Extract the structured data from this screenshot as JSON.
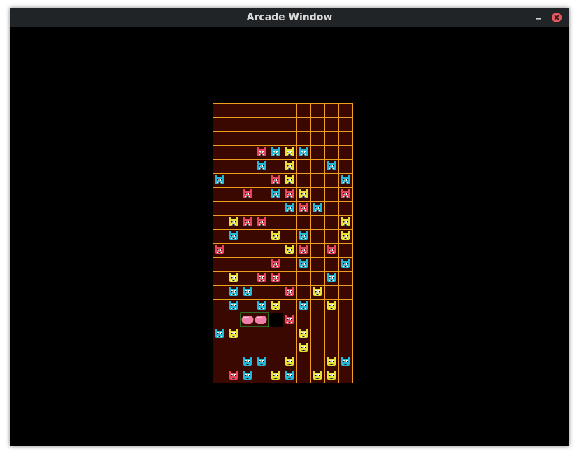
{
  "window": {
    "title": "Arcade Window",
    "minimize_icon": "minimize-icon",
    "close_icon": "close-icon",
    "close_color": "#e05a60"
  },
  "game": {
    "columns": 10,
    "rows": 20,
    "colors": {
      "cell_fill": "#3a0800",
      "grid_line": "#f0a020",
      "background": "#000000",
      "red_virus": "#e8455f",
      "yellow_virus": "#e6e233",
      "blue_virus": "#22b8d8",
      "capsule": "#f07fa8",
      "capsule_outline": "#20d040"
    },
    "viruses": [
      {
        "row": 3,
        "col": 3,
        "color": "red"
      },
      {
        "row": 3,
        "col": 4,
        "color": "blue"
      },
      {
        "row": 3,
        "col": 5,
        "color": "yellow"
      },
      {
        "row": 3,
        "col": 6,
        "color": "blue"
      },
      {
        "row": 4,
        "col": 3,
        "color": "blue"
      },
      {
        "row": 4,
        "col": 5,
        "color": "yellow"
      },
      {
        "row": 4,
        "col": 8,
        "color": "blue"
      },
      {
        "row": 5,
        "col": 0,
        "color": "blue"
      },
      {
        "row": 5,
        "col": 4,
        "color": "red"
      },
      {
        "row": 5,
        "col": 5,
        "color": "yellow"
      },
      {
        "row": 5,
        "col": 9,
        "color": "blue"
      },
      {
        "row": 6,
        "col": 2,
        "color": "red"
      },
      {
        "row": 6,
        "col": 4,
        "color": "blue"
      },
      {
        "row": 6,
        "col": 5,
        "color": "red"
      },
      {
        "row": 6,
        "col": 6,
        "color": "yellow"
      },
      {
        "row": 6,
        "col": 9,
        "color": "red"
      },
      {
        "row": 7,
        "col": 5,
        "color": "blue"
      },
      {
        "row": 7,
        "col": 6,
        "color": "red"
      },
      {
        "row": 7,
        "col": 7,
        "color": "blue"
      },
      {
        "row": 8,
        "col": 1,
        "color": "yellow"
      },
      {
        "row": 8,
        "col": 2,
        "color": "red"
      },
      {
        "row": 8,
        "col": 3,
        "color": "red"
      },
      {
        "row": 8,
        "col": 9,
        "color": "yellow"
      },
      {
        "row": 9,
        "col": 1,
        "color": "blue"
      },
      {
        "row": 9,
        "col": 4,
        "color": "yellow"
      },
      {
        "row": 9,
        "col": 6,
        "color": "blue"
      },
      {
        "row": 9,
        "col": 9,
        "color": "yellow"
      },
      {
        "row": 10,
        "col": 0,
        "color": "red"
      },
      {
        "row": 10,
        "col": 5,
        "color": "yellow"
      },
      {
        "row": 10,
        "col": 6,
        "color": "red"
      },
      {
        "row": 10,
        "col": 8,
        "color": "red"
      },
      {
        "row": 11,
        "col": 4,
        "color": "red"
      },
      {
        "row": 11,
        "col": 6,
        "color": "blue"
      },
      {
        "row": 11,
        "col": 9,
        "color": "blue"
      },
      {
        "row": 12,
        "col": 1,
        "color": "yellow"
      },
      {
        "row": 12,
        "col": 3,
        "color": "red"
      },
      {
        "row": 12,
        "col": 4,
        "color": "red"
      },
      {
        "row": 12,
        "col": 8,
        "color": "blue"
      },
      {
        "row": 13,
        "col": 1,
        "color": "blue"
      },
      {
        "row": 13,
        "col": 2,
        "color": "blue"
      },
      {
        "row": 13,
        "col": 5,
        "color": "red"
      },
      {
        "row": 13,
        "col": 7,
        "color": "yellow"
      },
      {
        "row": 14,
        "col": 1,
        "color": "blue"
      },
      {
        "row": 14,
        "col": 3,
        "color": "blue"
      },
      {
        "row": 14,
        "col": 4,
        "color": "yellow"
      },
      {
        "row": 14,
        "col": 6,
        "color": "blue"
      },
      {
        "row": 14,
        "col": 8,
        "color": "yellow"
      },
      {
        "row": 15,
        "col": 5,
        "color": "red"
      },
      {
        "row": 16,
        "col": 0,
        "color": "blue"
      },
      {
        "row": 16,
        "col": 1,
        "color": "yellow"
      },
      {
        "row": 16,
        "col": 6,
        "color": "yellow"
      },
      {
        "row": 17,
        "col": 6,
        "color": "yellow"
      },
      {
        "row": 18,
        "col": 2,
        "color": "blue"
      },
      {
        "row": 18,
        "col": 3,
        "color": "blue"
      },
      {
        "row": 18,
        "col": 5,
        "color": "yellow"
      },
      {
        "row": 18,
        "col": 8,
        "color": "yellow"
      },
      {
        "row": 18,
        "col": 9,
        "color": "blue"
      },
      {
        "row": 19,
        "col": 1,
        "color": "red"
      },
      {
        "row": 19,
        "col": 2,
        "color": "blue"
      },
      {
        "row": 19,
        "col": 4,
        "color": "yellow"
      },
      {
        "row": 19,
        "col": 5,
        "color": "blue"
      },
      {
        "row": 19,
        "col": 7,
        "color": "yellow"
      },
      {
        "row": 19,
        "col": 8,
        "color": "yellow"
      }
    ],
    "active_capsule": {
      "row": 15,
      "col_start": 2,
      "length": 2,
      "color": "pink"
    },
    "black_cells": [
      {
        "row": 15,
        "col": 4
      }
    ]
  }
}
